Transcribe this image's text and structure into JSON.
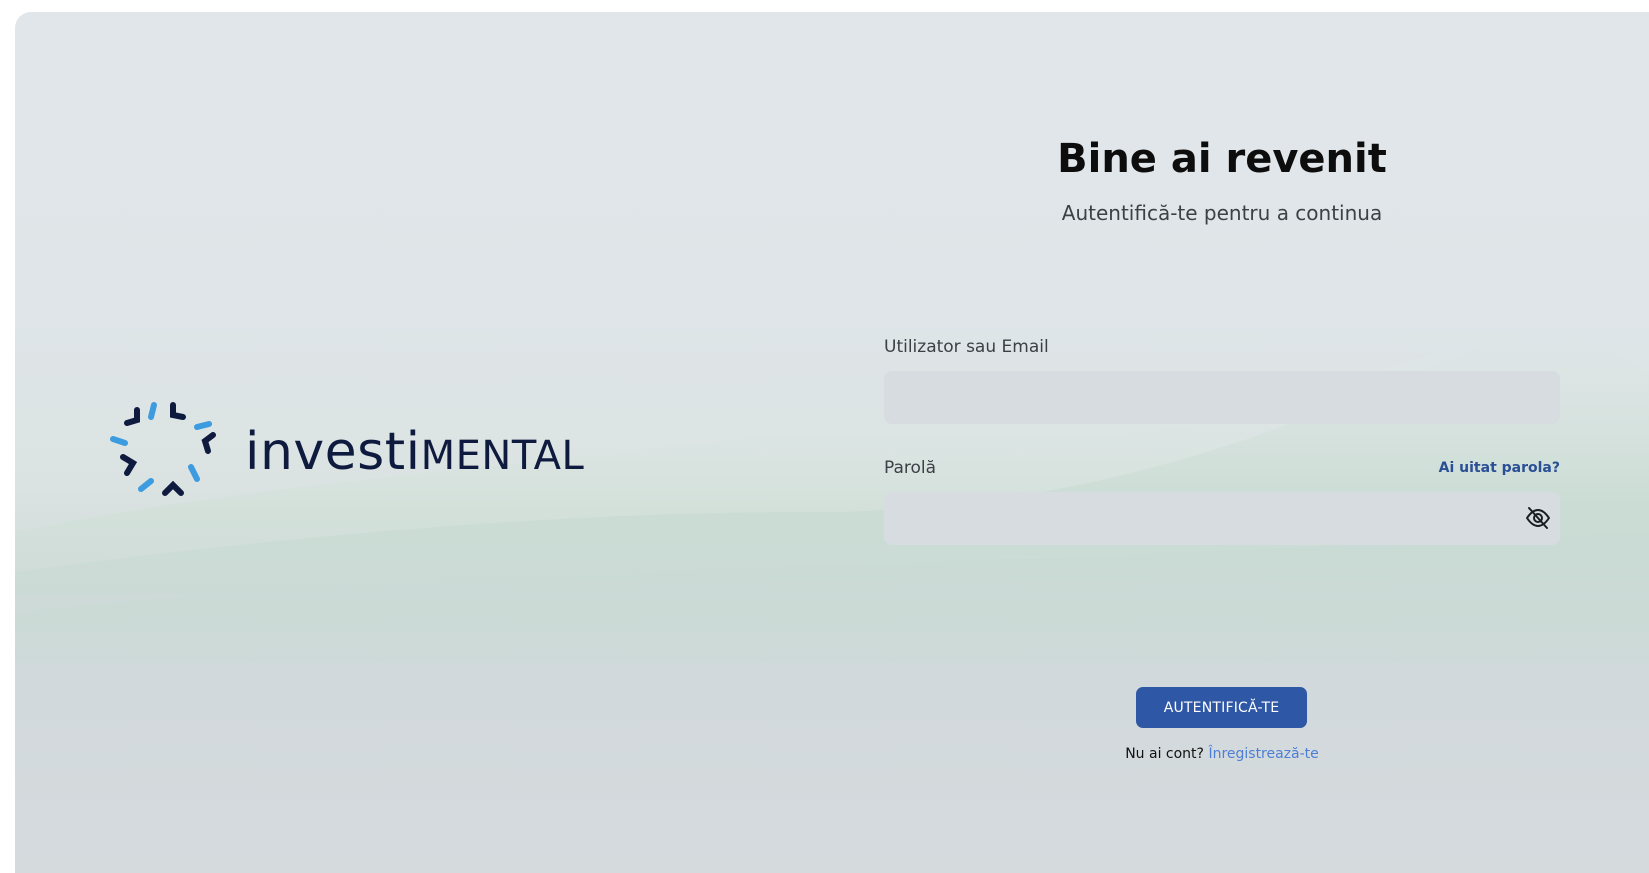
{
  "brand": {
    "name_prefix": "inve",
    "name_st": "st",
    "name_i": "i",
    "name_suffix": "MENTAL",
    "colors": {
      "navy": "#0e1b3f",
      "blue": "#3d9be0"
    }
  },
  "login": {
    "title": "Bine ai revenit",
    "subtitle": "Autentifică-te pentru a continua",
    "username_label": "Utilizator sau Email",
    "username_value": "",
    "password_label": "Parolă",
    "password_value": "",
    "forgot_link": "Ai uitat parola?",
    "password_toggle_icon": "eye-off-icon",
    "submit_label": "AUTENTIFICĂ-TE",
    "no_account_text": "Nu ai cont?",
    "register_link": "Înregistrează-te"
  },
  "colors": {
    "primary": "#2e57a6",
    "link": "#4d7fd6",
    "link_strong": "#2a4f95",
    "input_bg": "#d6dce0"
  }
}
